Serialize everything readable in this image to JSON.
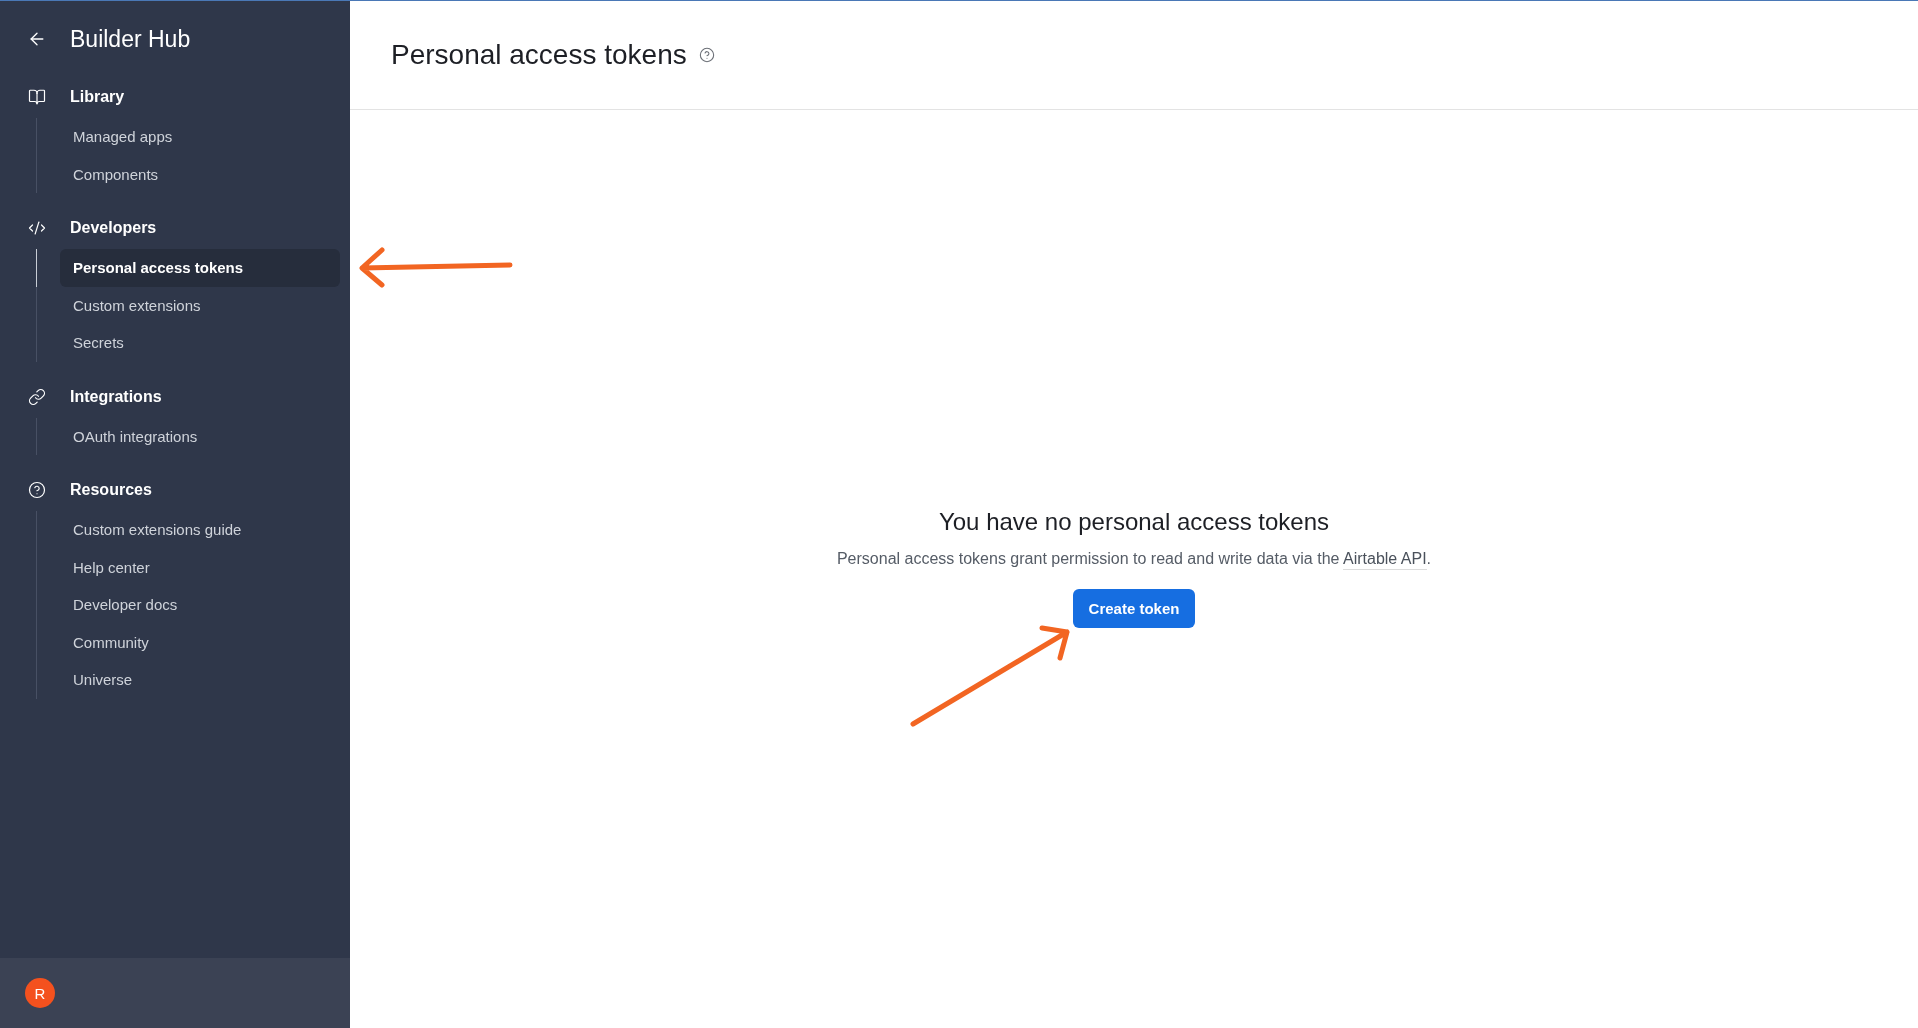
{
  "sidebar": {
    "title": "Builder Hub",
    "sections": [
      {
        "label": "Library",
        "items": [
          {
            "label": "Managed apps",
            "selected": false,
            "annotated": false
          },
          {
            "label": "Components",
            "selected": false,
            "annotated": false
          }
        ]
      },
      {
        "label": "Developers",
        "items": [
          {
            "label": "Personal access tokens",
            "selected": true,
            "annotated": true
          },
          {
            "label": "Custom extensions",
            "selected": false,
            "annotated": false
          },
          {
            "label": "Secrets",
            "selected": false,
            "annotated": false
          }
        ]
      },
      {
        "label": "Integrations",
        "items": [
          {
            "label": "OAuth integrations",
            "selected": false,
            "annotated": false
          }
        ]
      },
      {
        "label": "Resources",
        "items": [
          {
            "label": "Custom extensions guide",
            "selected": false,
            "annotated": false
          },
          {
            "label": "Help center",
            "selected": false,
            "annotated": false
          },
          {
            "label": "Developer docs",
            "selected": false,
            "annotated": false
          },
          {
            "label": "Community",
            "selected": false,
            "annotated": false
          },
          {
            "label": "Universe",
            "selected": false,
            "annotated": false
          }
        ]
      }
    ],
    "avatar": {
      "initial": "R"
    }
  },
  "header": {
    "title": "Personal access tokens"
  },
  "empty_state": {
    "heading": "You have no personal access tokens",
    "description": "Personal access tokens grant permission to read and write data via the",
    "link": "Airtable API",
    "description_end": ".",
    "button": {
      "label": "Create token",
      "annotated": true
    }
  }
}
